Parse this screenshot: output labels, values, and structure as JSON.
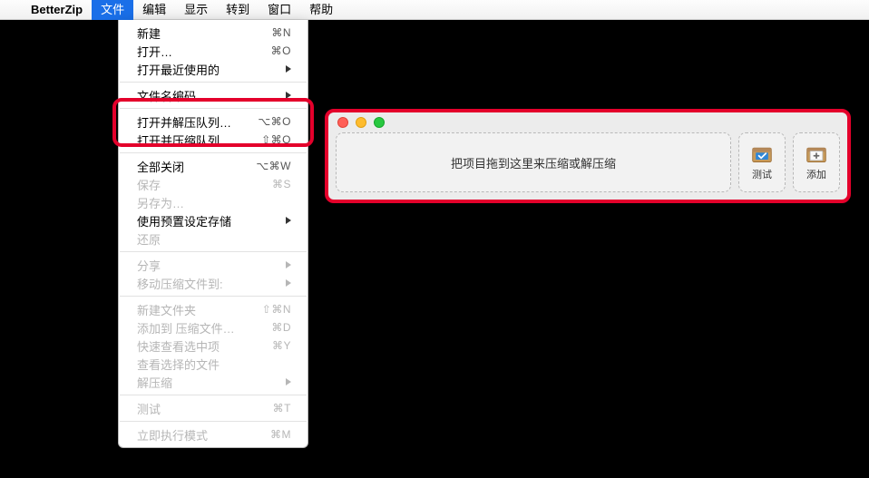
{
  "menubar": {
    "app_name": "BetterZip",
    "items": [
      "文件",
      "编辑",
      "显示",
      "转到",
      "窗口",
      "帮助"
    ],
    "active_index": 0
  },
  "dropdown": {
    "groups": [
      [
        {
          "label": "新建",
          "shortcut": "⌘N",
          "disabled": false
        },
        {
          "label": "打开…",
          "shortcut": "⌘O",
          "disabled": false
        },
        {
          "label": "打开最近使用的",
          "submenu": true,
          "disabled": false
        }
      ],
      [
        {
          "label": "文件名编码",
          "submenu": true,
          "disabled": false
        }
      ],
      [
        {
          "label": "打开并解压队列…",
          "shortcut": "⌥⌘O",
          "disabled": false
        },
        {
          "label": "打开并压缩队列…",
          "shortcut": "⇧⌘O",
          "disabled": false
        }
      ],
      [
        {
          "label": "全部关闭",
          "shortcut": "⌥⌘W",
          "disabled": false
        },
        {
          "label": "保存",
          "shortcut": "⌘S",
          "disabled": true
        },
        {
          "label": "另存为…",
          "shortcut": "",
          "disabled": true
        },
        {
          "label": "使用预置设定存储",
          "submenu": true,
          "disabled": false
        },
        {
          "label": "还原",
          "shortcut": "",
          "disabled": true
        }
      ],
      [
        {
          "label": "分享",
          "submenu": true,
          "disabled": true
        },
        {
          "label": "移动压缩文件到:",
          "submenu": true,
          "disabled": true
        }
      ],
      [
        {
          "label": "新建文件夹",
          "shortcut": "⇧⌘N",
          "disabled": true
        },
        {
          "label": "添加到 压缩文件…",
          "shortcut": "⌘D",
          "disabled": true
        },
        {
          "label": "快速查看选中项",
          "shortcut": "⌘Y",
          "disabled": true
        },
        {
          "label": "查看选择的文件",
          "shortcut": "",
          "disabled": true
        },
        {
          "label": "解压缩",
          "submenu": true,
          "disabled": true
        }
      ],
      [
        {
          "label": "测试",
          "shortcut": "⌘T",
          "disabled": true
        }
      ],
      [
        {
          "label": "立即执行模式",
          "shortcut": "⌘M",
          "disabled": true
        }
      ]
    ]
  },
  "window": {
    "dropzone_text": "把项目拖到这里来压缩或解压缩",
    "buttons": {
      "test": "测试",
      "add": "添加"
    }
  }
}
